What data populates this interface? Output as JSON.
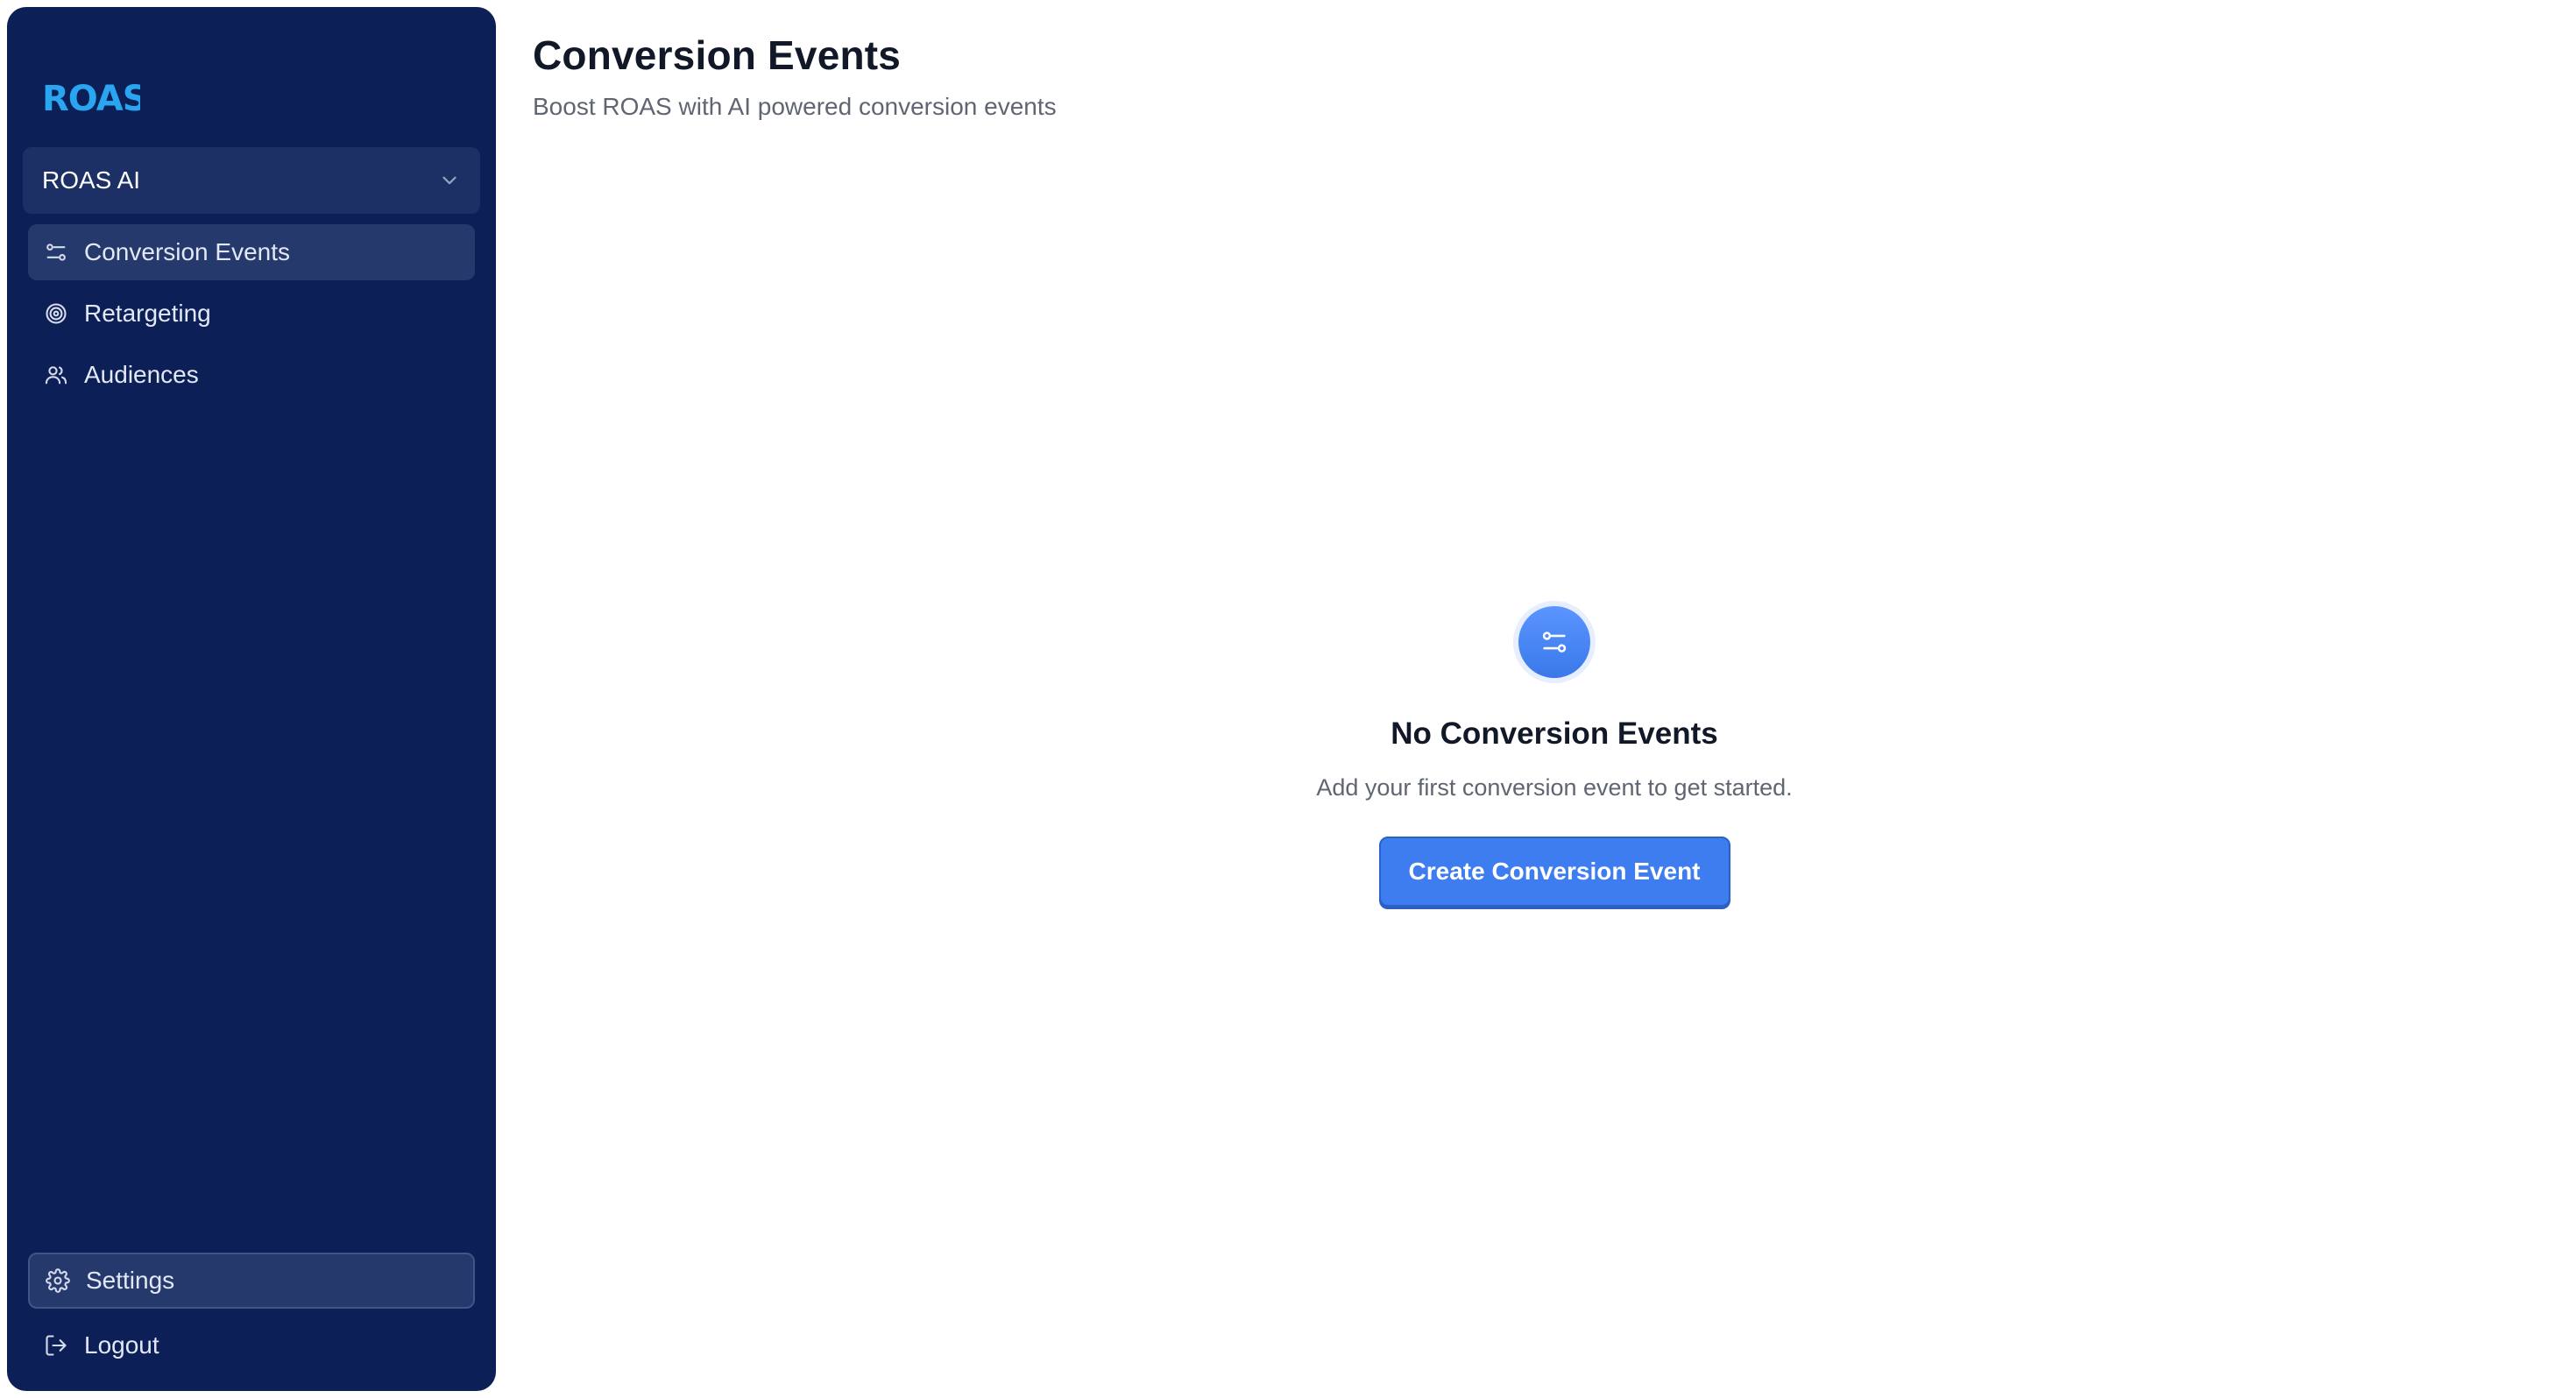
{
  "brand": {
    "logo_text": "ROAS",
    "logo_color": "#2aa6f0"
  },
  "sidebar": {
    "workspace": {
      "label": "ROAS AI",
      "icon": "chevron-down-icon"
    },
    "items": [
      {
        "label": "Conversion Events",
        "icon": "sliders-icon",
        "active": true
      },
      {
        "label": "Retargeting",
        "icon": "target-icon",
        "active": false
      },
      {
        "label": "Audiences",
        "icon": "users-icon",
        "active": false
      }
    ],
    "bottom_items": [
      {
        "label": "Settings",
        "icon": "gear-icon"
      },
      {
        "label": "Logout",
        "icon": "logout-icon"
      }
    ],
    "bg_color": "#0c1f57"
  },
  "header": {
    "title": "Conversion Events",
    "subtitle": "Boost ROAS with AI powered conversion events"
  },
  "empty_state": {
    "icon": "sliders-icon",
    "title": "No Conversion Events",
    "text": "Add your first conversion event to get started.",
    "button_label": "Create Conversion Event",
    "accent_color": "#3e7df0"
  }
}
